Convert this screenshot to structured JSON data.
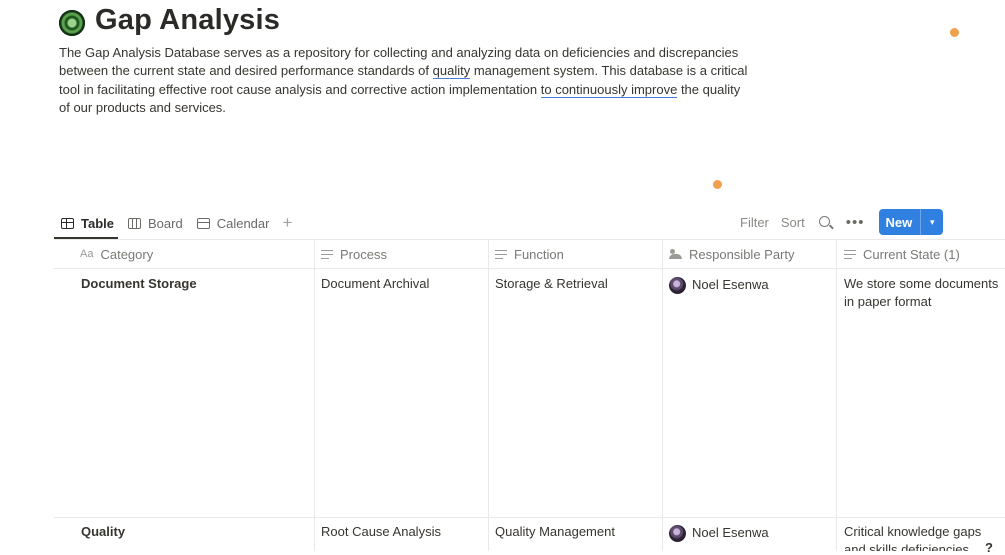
{
  "page": {
    "title": "Gap Analysis",
    "description_parts": [
      "The Gap Analysis Database serves as a repository for collecting and analyzing data on deficiencies and discrepancies between the current state and desired performance standards of ",
      "quality",
      " management system. This database is a critical tool in facilitating effective root cause analysis and corrective action implementation ",
      "to continuously improve",
      " the quality of our products and services."
    ]
  },
  "views": {
    "tabs": [
      {
        "label": "Table",
        "icon": "table-icon",
        "active": true
      },
      {
        "label": "Board",
        "icon": "board-icon",
        "active": false
      },
      {
        "label": "Calendar",
        "icon": "calendar-icon",
        "active": false
      }
    ],
    "add_icon": "+"
  },
  "toolbar": {
    "filter": "Filter",
    "sort": "Sort",
    "more": "•••",
    "new": "New",
    "new_chevron": "▾"
  },
  "table": {
    "columns": [
      {
        "label": "Category",
        "icon": "Aa"
      },
      {
        "label": "Process",
        "icon": "text-lines-icon"
      },
      {
        "label": "Function",
        "icon": "text-lines-icon"
      },
      {
        "label": "Responsible Party",
        "icon": "people-icon"
      },
      {
        "label": "Current State (1)",
        "icon": "text-lines-icon"
      }
    ],
    "rows": [
      {
        "category": "Document Storage",
        "process": "Document Archival",
        "function": "Storage & Retrieval",
        "responsible": "Noel Esenwa",
        "current_state": "We store some documents in paper format"
      },
      {
        "category": "Quality",
        "process": "Root Cause Analysis",
        "function": "Quality Management",
        "responsible": "Noel Esenwa",
        "current_state": "Critical knowledge gaps and skills deficiencies amo..."
      }
    ]
  },
  "help": "?",
  "colors": {
    "accent": "#2f80e0",
    "dot": "#f0a04b"
  }
}
